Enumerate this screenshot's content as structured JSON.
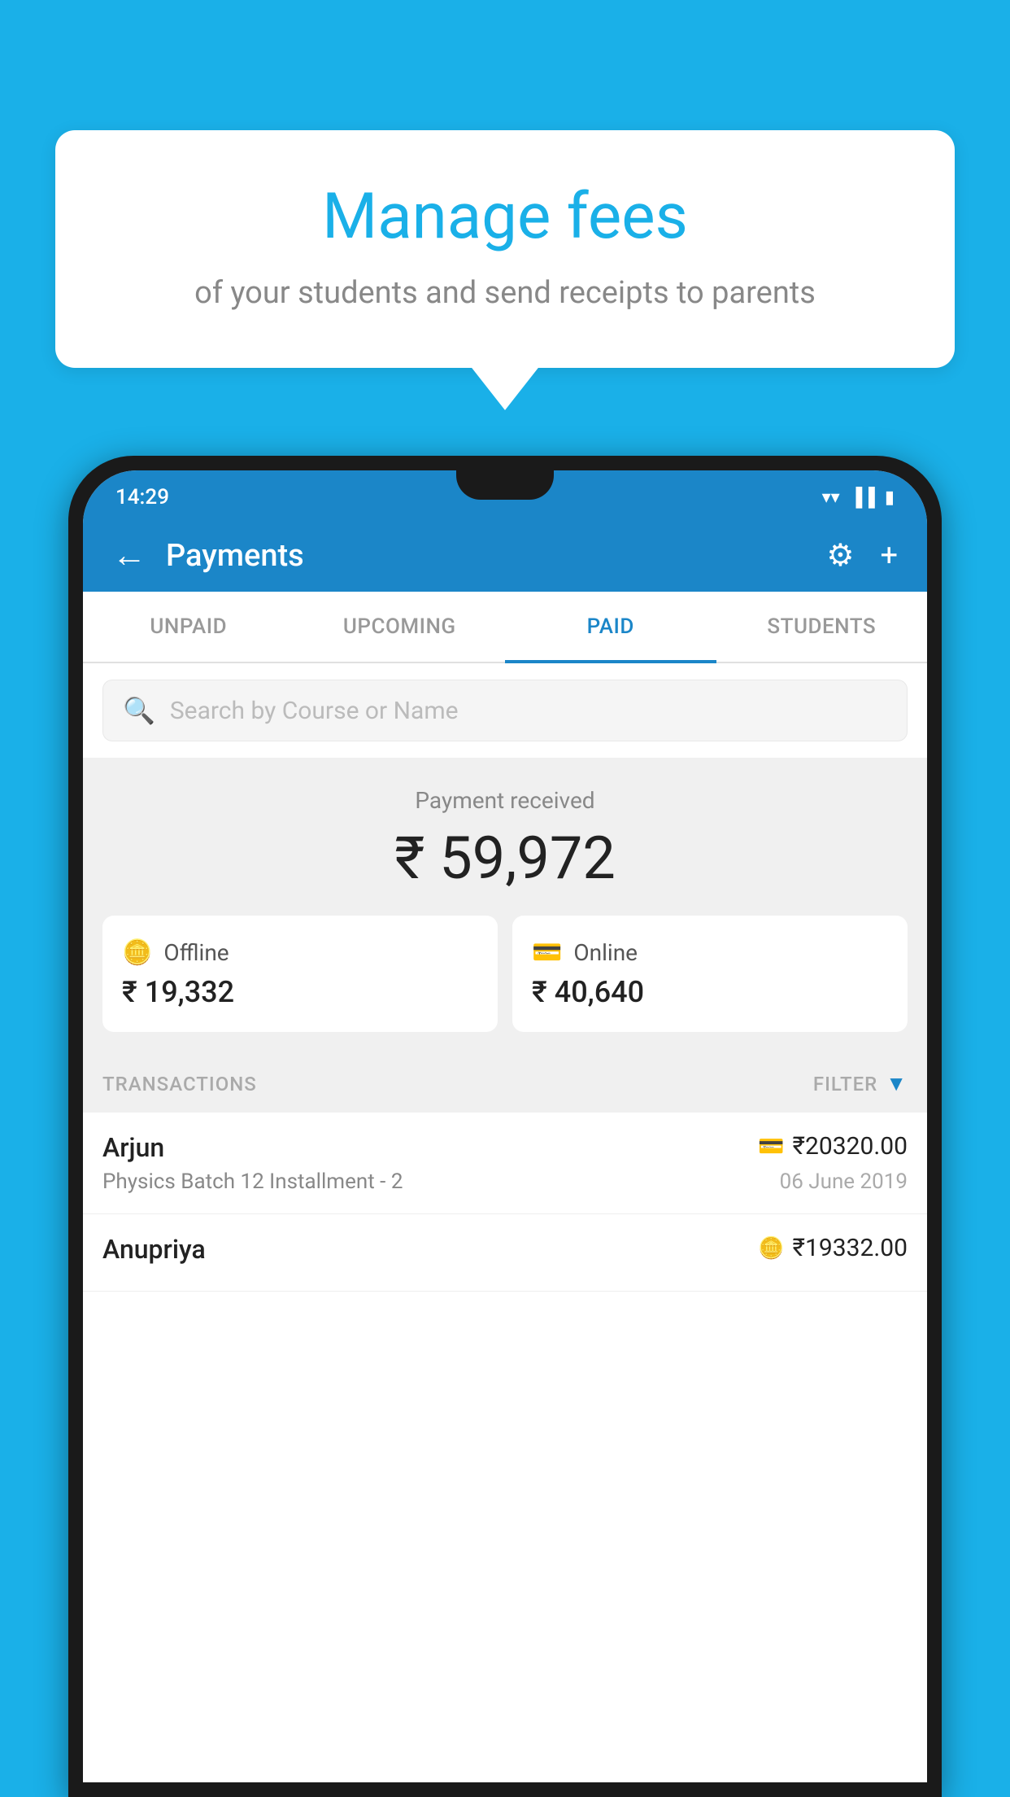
{
  "bubble": {
    "title": "Manage fees",
    "subtitle": "of your students and send receipts to parents"
  },
  "statusBar": {
    "time": "14:29",
    "wifi": "▲",
    "signal": "▲",
    "battery": "▮"
  },
  "appBar": {
    "title": "Payments",
    "backLabel": "←",
    "gearLabel": "⚙",
    "plusLabel": "+"
  },
  "tabs": [
    {
      "label": "UNPAID",
      "active": false
    },
    {
      "label": "UPCOMING",
      "active": false
    },
    {
      "label": "PAID",
      "active": true
    },
    {
      "label": "STUDENTS",
      "active": false
    }
  ],
  "search": {
    "placeholder": "Search by Course or Name"
  },
  "paymentSummary": {
    "label": "Payment received",
    "amount": "₹ 59,972"
  },
  "paymentCards": [
    {
      "type": "Offline",
      "amount": "₹ 19,332",
      "icon": "💳"
    },
    {
      "type": "Online",
      "amount": "₹ 40,640",
      "icon": "💳"
    }
  ],
  "transactionsSection": {
    "label": "TRANSACTIONS",
    "filterLabel": "FILTER"
  },
  "transactions": [
    {
      "name": "Arjun",
      "course": "Physics Batch 12 Installment - 2",
      "amount": "₹20320.00",
      "date": "06 June 2019",
      "paymentType": "online"
    },
    {
      "name": "Anupriya",
      "course": "",
      "amount": "₹19332.00",
      "date": "",
      "paymentType": "offline"
    }
  ]
}
